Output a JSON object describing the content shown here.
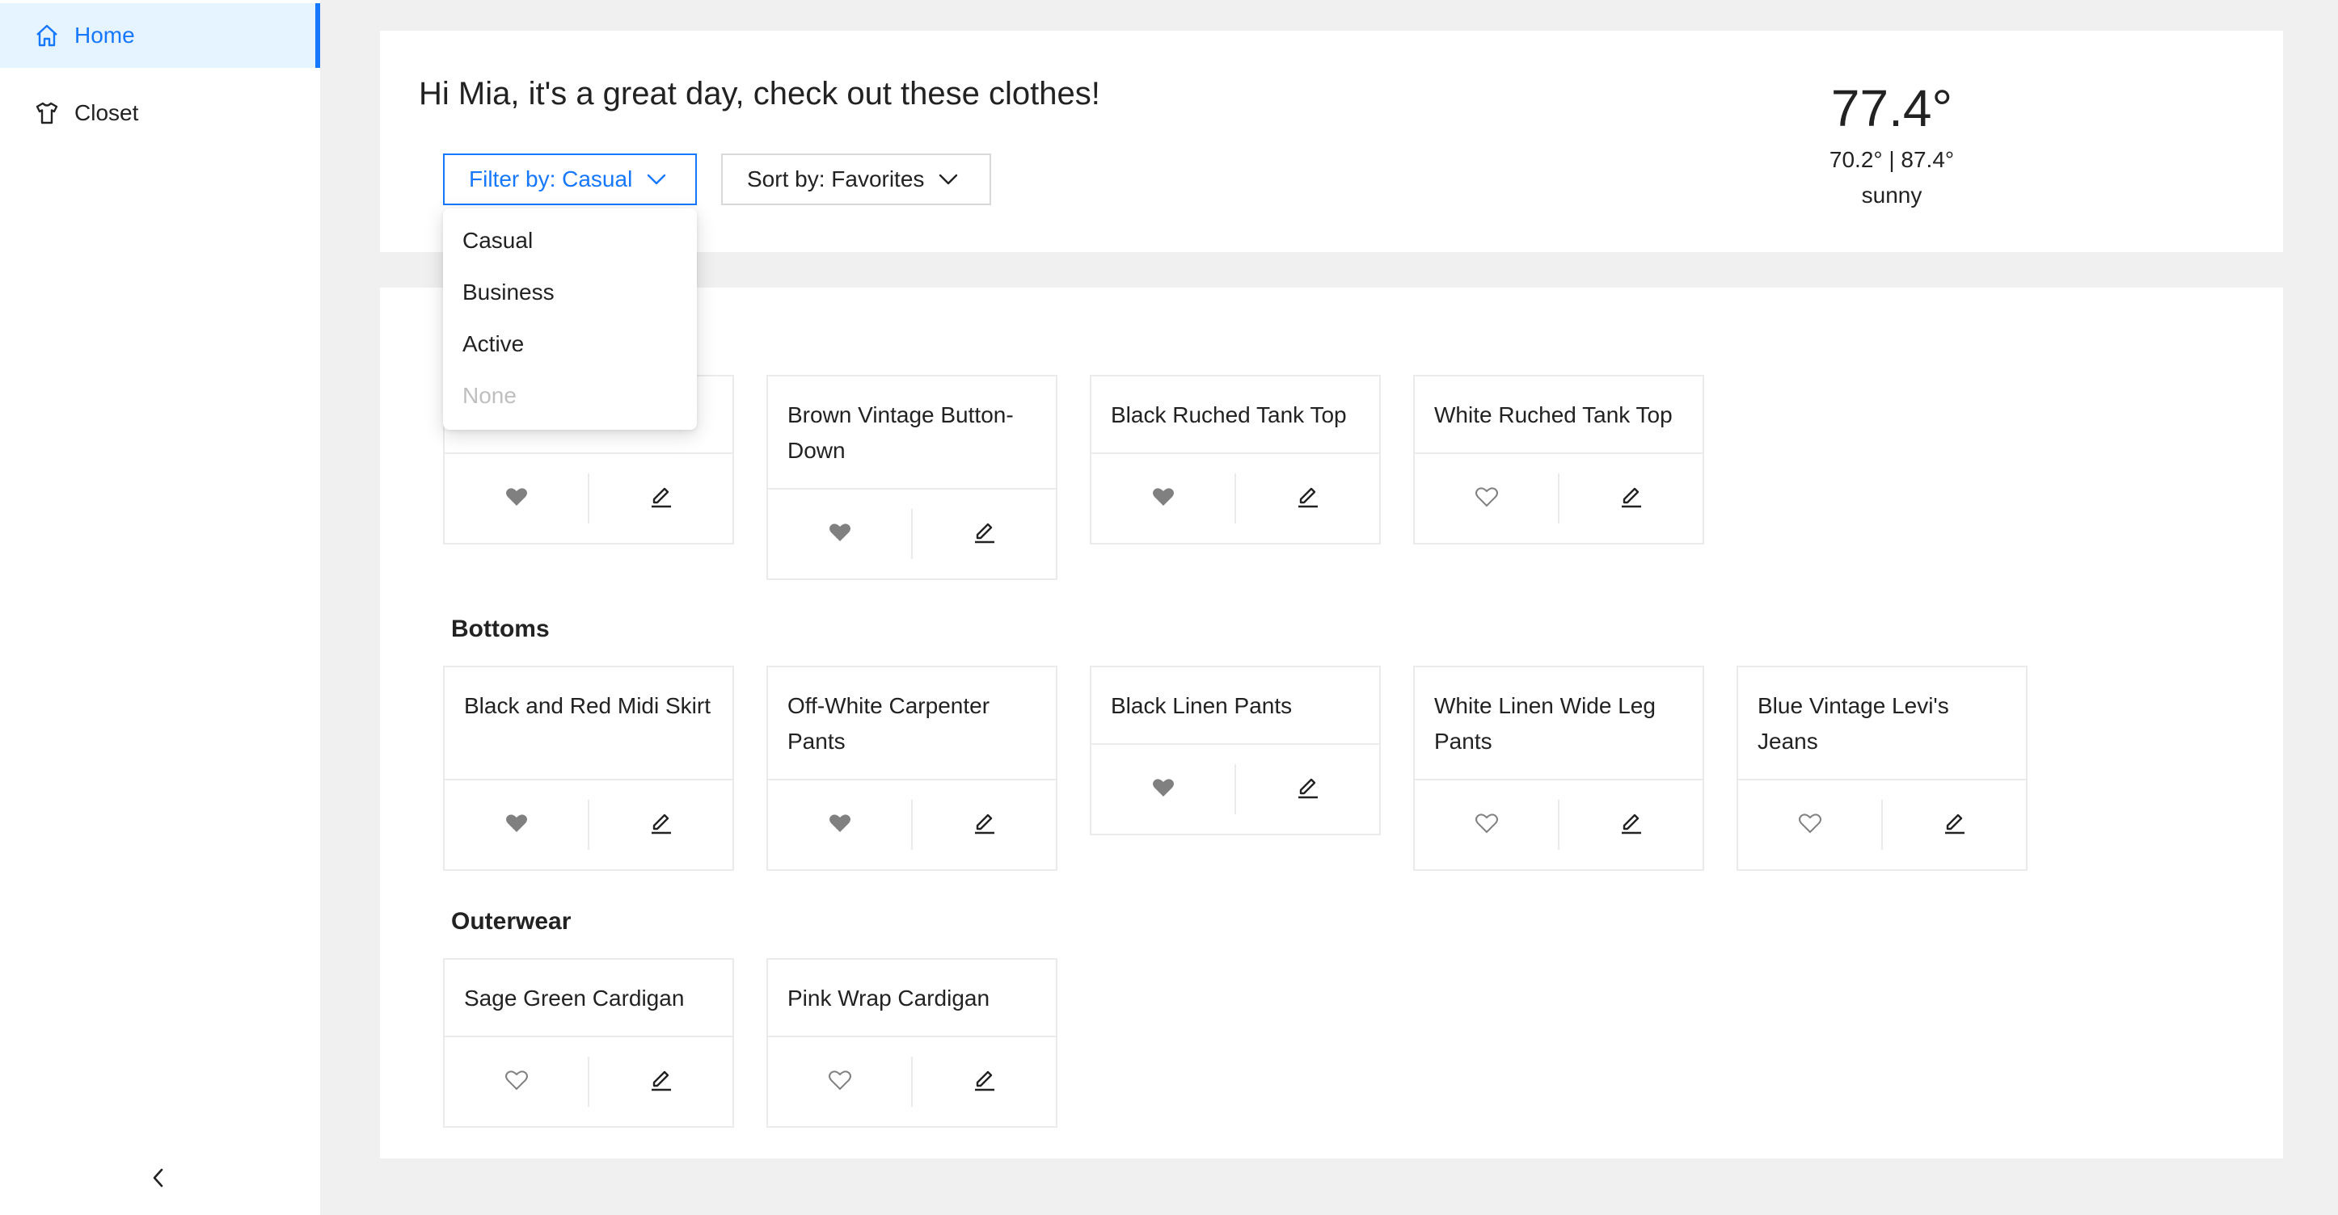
{
  "sidebar": {
    "items": [
      {
        "label": "Home",
        "icon": "home-icon",
        "active": true
      },
      {
        "label": "Closet",
        "icon": "shirt-icon",
        "active": false
      }
    ],
    "collapse_icon": "chevron-left-icon"
  },
  "header": {
    "greeting": "Hi Mia, it's a great day, check out these clothes!",
    "filter_label": "Filter by: Casual",
    "sort_label": "Sort by: Favorites",
    "weather": {
      "temp": "77.4°",
      "range": "70.2° | 87.4°",
      "condition": "sunny"
    }
  },
  "filter_menu": {
    "options": [
      {
        "label": "Casual",
        "disabled": false
      },
      {
        "label": "Business",
        "disabled": false
      },
      {
        "label": "Active",
        "disabled": false
      },
      {
        "label": "None",
        "disabled": true
      }
    ]
  },
  "sections": [
    {
      "title": "",
      "items": [
        {
          "name": "",
          "favorite": true
        },
        {
          "name": "Brown Vintage Button-Down",
          "favorite": true
        },
        {
          "name": "Black Ruched Tank Top",
          "favorite": true
        },
        {
          "name": "White Ruched Tank Top",
          "favorite": false
        }
      ]
    },
    {
      "title": "Bottoms",
      "items": [
        {
          "name": "Black and Red Midi Skirt",
          "favorite": true
        },
        {
          "name": "Off-White Carpenter Pants",
          "favorite": true
        },
        {
          "name": "Black Linen Pants",
          "favorite": true
        },
        {
          "name": "White Linen Wide Leg Pants",
          "favorite": false
        },
        {
          "name": "Blue Vintage Levi's Jeans",
          "favorite": false
        }
      ]
    },
    {
      "title": "Outerwear",
      "items": [
        {
          "name": "Sage Green Cardigan",
          "favorite": false
        },
        {
          "name": "Pink Wrap Cardigan",
          "favorite": false
        }
      ]
    }
  ],
  "colors": {
    "accent": "#1677ff",
    "accent_bg": "#e6f4ff",
    "heart": "#808080",
    "background": "#f0f0f0"
  }
}
